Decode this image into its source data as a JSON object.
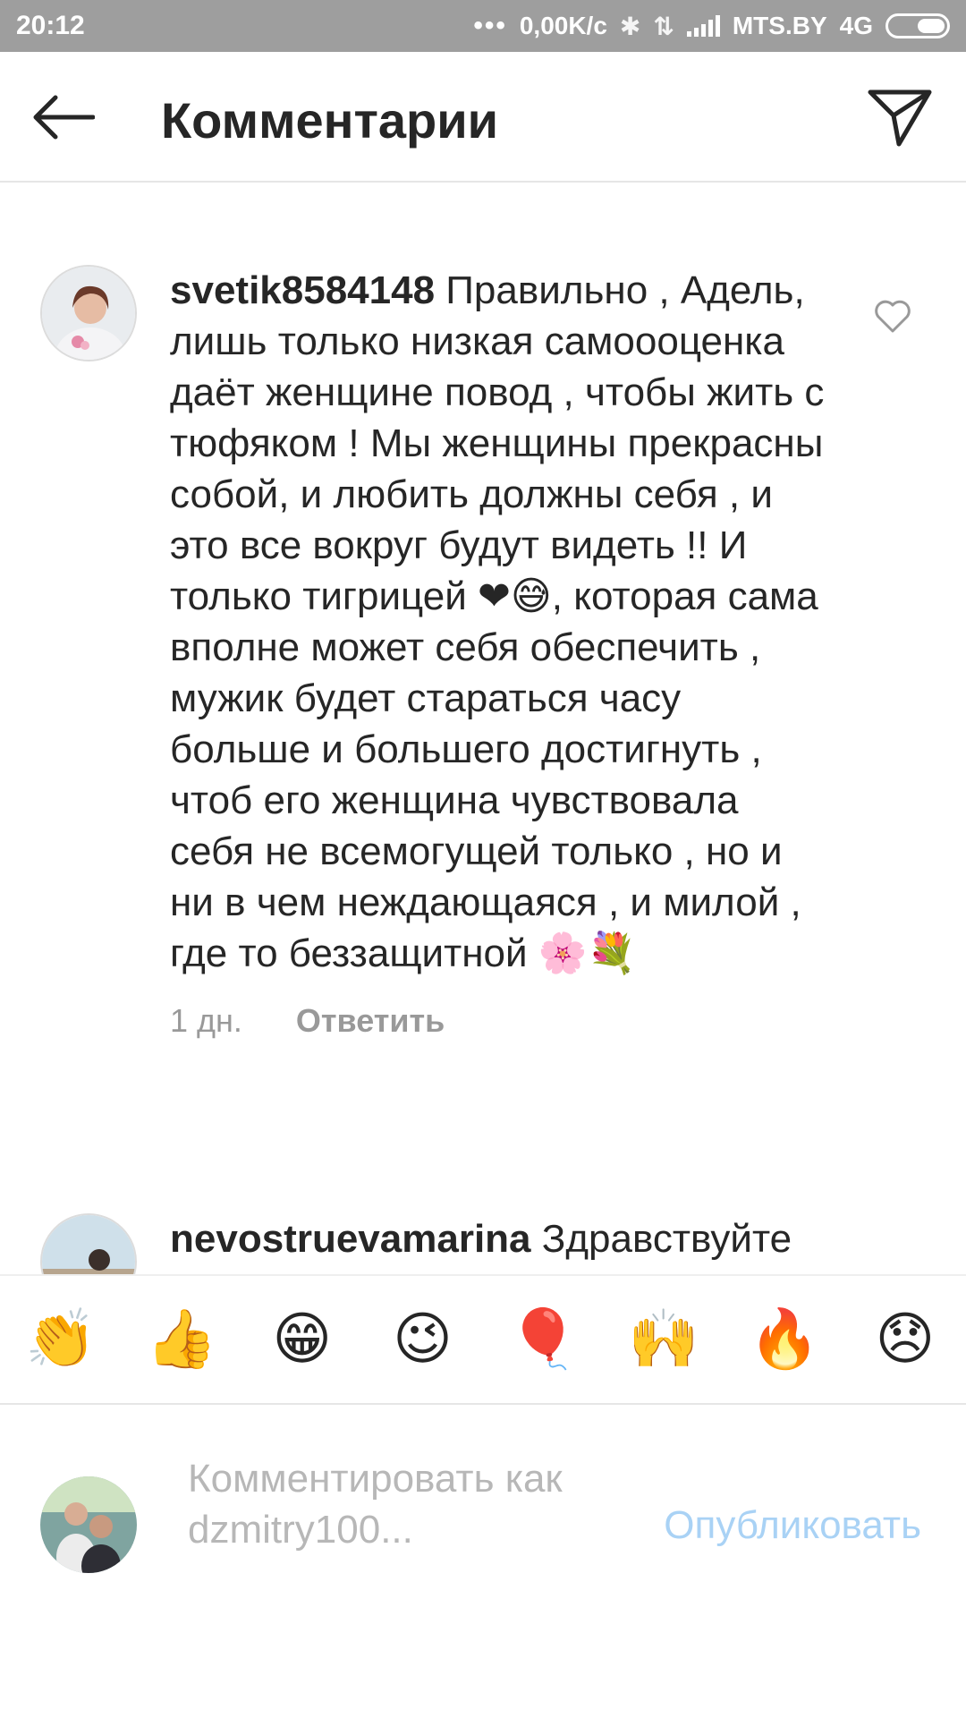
{
  "status_bar": {
    "time": "20:12",
    "speed": "0,00K/c",
    "carrier": "MTS.BY",
    "network": "4G"
  },
  "header": {
    "title": "Комментарии"
  },
  "comments": [
    {
      "username": "svetik8584148",
      "text_parts": [
        " Правильно , Адель, лишь только низкая самоооценка даёт женщине повод , чтобы жить с тюфяком ! Мы женщины прекрасны собой, и любить должны себя , и это все вокруг будут видеть !! И только тигрицей ",
        "❤😅",
        ", которая сама вполне может себя обеспечить , мужик будет стараться часу больше и большего достигнуть , чтоб его женщина чувствовала себя не всемогущей только , но и ни в чем неждающаяся , и милой , где то беззащитной ",
        "🌸💐"
      ],
      "time_ago": "1 дн.",
      "reply_label": "Ответить"
    },
    {
      "username": "nevostruevamarina",
      "text": " Здравствуйте"
    }
  ],
  "emoji_bar": [
    "👏",
    "👍",
    "😁",
    "😉",
    "🎈",
    "🙌",
    "🔥",
    "😞"
  ],
  "compose": {
    "placeholder": "Комментировать как dzmitry100...",
    "publish_label": "Опубликовать"
  },
  "colors": {
    "status_bar": "#9e9e9e",
    "publish_disabled": "#a9d2f5",
    "muted": "#999999"
  }
}
